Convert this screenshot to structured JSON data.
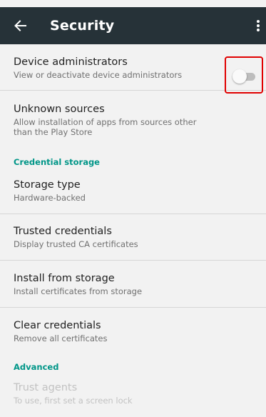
{
  "app_bar": {
    "title": "Security",
    "back_icon": "arrow-back-icon",
    "overflow_icon": "more-vert-icon",
    "background": "#263238"
  },
  "items": {
    "device_admins": {
      "title": "Device administrators",
      "summary": "View or deactivate device administrators"
    },
    "unknown_sources": {
      "title": "Unknown sources",
      "summary": "Allow installation of apps from sources other than the Play Store",
      "toggle_on": false
    },
    "storage_type": {
      "title": "Storage type",
      "summary": "Hardware-backed"
    },
    "trusted_credentials": {
      "title": "Trusted credentials",
      "summary": "Display trusted CA certificates"
    },
    "install_from_storage": {
      "title": "Install from storage",
      "summary": "Install certificates from storage"
    },
    "clear_credentials": {
      "title": "Clear credentials",
      "summary": "Remove all certificates"
    },
    "trust_agents": {
      "title": "Trust agents",
      "summary": "To use, first set a screen lock"
    }
  },
  "categories": {
    "credential_storage": "Credential storage",
    "advanced": "Advanced"
  },
  "colors": {
    "accent": "#009688",
    "highlight_box": "#e00000"
  }
}
